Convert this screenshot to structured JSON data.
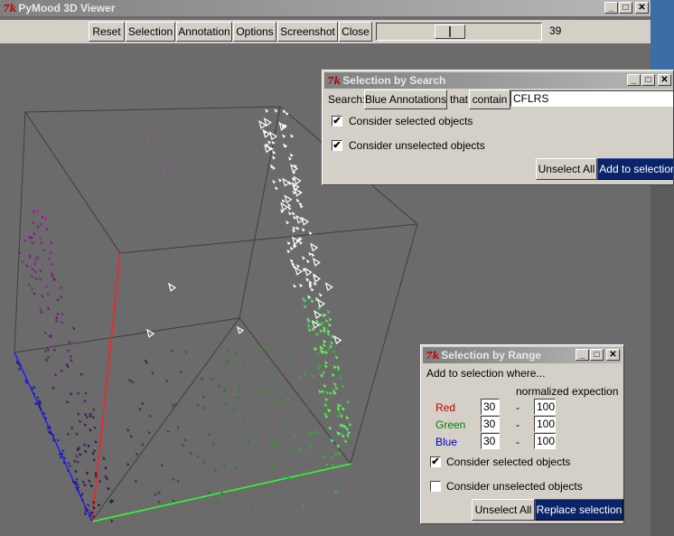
{
  "main_window": {
    "tk_logo": "7k",
    "title": "PyMood 3D Viewer",
    "toolbar": {
      "reset": "Reset",
      "selection": "Selection",
      "annotation": "Annotation",
      "options": "Options",
      "screenshot": "Screenshot",
      "close": "Close"
    },
    "slider_value": "39",
    "slider_fraction": 0.39
  },
  "search_dialog": {
    "tk_logo": "7k",
    "title": "Selection by Search",
    "search_label": "Search:",
    "field_button": "Blue Annotations",
    "that_label": "that",
    "op_button": "contain",
    "search_value": "CFLRS",
    "consider_selected": "Consider selected objects",
    "consider_selected_checked": true,
    "consider_unselected": "Consider unselected objects",
    "consider_unselected_checked": true,
    "unselect_all": "Unselect All",
    "add_to_selection": "Add to selection"
  },
  "range_dialog": {
    "tk_logo": "7k",
    "title": "Selection by Range",
    "intro": "Add to selection where...",
    "header": "normalized expection",
    "rows": [
      {
        "label": "Red",
        "color": "#c00000",
        "min": "30",
        "sep": "-",
        "max": "100"
      },
      {
        "label": "Green",
        "color": "#008000",
        "min": "30",
        "sep": "-",
        "max": "100"
      },
      {
        "label": "Blue",
        "color": "#0000c0",
        "min": "30",
        "sep": "-",
        "max": "100"
      }
    ],
    "consider_selected": "Consider selected objects",
    "consider_selected_checked": true,
    "consider_unselected": "Consider unselected objects",
    "consider_unselected_checked": false,
    "unselect_all": "Unselect All",
    "replace_selection": "Replace selection"
  },
  "window_controls": {
    "minimize": "_",
    "maximize": "□",
    "close": "✕"
  },
  "check_mark": "✔",
  "colors": {
    "viewport_bg": "#6b6b6b",
    "axis_red": "#ff2020",
    "axis_green": "#30ff30",
    "axis_blue": "#2020ff",
    "accent": "#0a246a"
  }
}
